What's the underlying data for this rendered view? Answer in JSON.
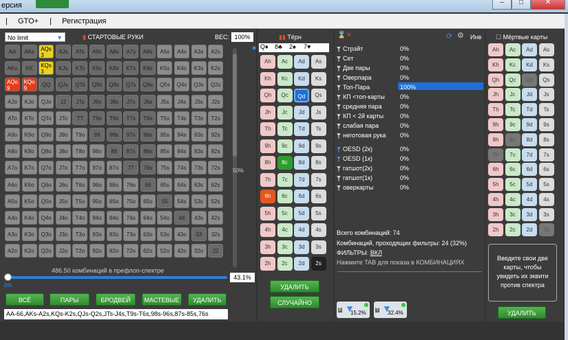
{
  "title": "ерсия",
  "menu": [
    "GTO+",
    "Регистрация"
  ],
  "left": {
    "limit_select": "No limit",
    "starting_hands_label": "СТАРТОВЫЕ РУКИ",
    "weight_label": "ВЕС:",
    "weight_value": "100%",
    "matrix": [
      [
        "AA",
        "AKs",
        "AQs",
        "AJs",
        "ATs",
        "A9s",
        "A8s",
        "A7s",
        "A6s",
        "A5s",
        "A4s",
        "A3s",
        "A2s"
      ],
      [
        "AKo",
        "KK",
        "KQs",
        "KJs",
        "KTs",
        "K9s",
        "K8s",
        "K7s",
        "K6s",
        "K5s",
        "K4s",
        "K3s",
        "K2s"
      ],
      [
        "AQo",
        "KQo",
        "QQ",
        "QJs",
        "QTs",
        "Q9s",
        "Q8s",
        "Q7s",
        "Q6s",
        "Q5s",
        "Q4s",
        "Q3s",
        "Q2s"
      ],
      [
        "AJo",
        "KJo",
        "QJo",
        "JJ",
        "JTs",
        "J9s",
        "J8s",
        "J7s",
        "J6s",
        "J5s",
        "J4s",
        "J3s",
        "J2s"
      ],
      [
        "ATo",
        "KTo",
        "QTo",
        "JTo",
        "TT",
        "T9s",
        "T8s",
        "T7s",
        "T6s",
        "T5s",
        "T4s",
        "T3s",
        "T2s"
      ],
      [
        "A9o",
        "K9o",
        "Q9o",
        "J9o",
        "T9o",
        "99",
        "98s",
        "97s",
        "96s",
        "95s",
        "94s",
        "93s",
        "92s"
      ],
      [
        "A8o",
        "K8o",
        "Q8o",
        "J8o",
        "T8o",
        "98o",
        "88",
        "87s",
        "86s",
        "85s",
        "84s",
        "83s",
        "82s"
      ],
      [
        "A7o",
        "K7o",
        "Q7o",
        "J7o",
        "T7o",
        "97o",
        "87o",
        "77",
        "76s",
        "75s",
        "74s",
        "73s",
        "72s"
      ],
      [
        "A6o",
        "K6o",
        "Q6o",
        "J6o",
        "T6o",
        "96o",
        "86o",
        "76o",
        "66",
        "65s",
        "64s",
        "63s",
        "62s"
      ],
      [
        "A5o",
        "K5o",
        "Q5o",
        "J5o",
        "T5o",
        "95o",
        "85o",
        "75o",
        "65o",
        "55",
        "54s",
        "53s",
        "52s"
      ],
      [
        "A4o",
        "K4o",
        "Q4o",
        "J4o",
        "T4o",
        "94o",
        "84o",
        "74o",
        "64o",
        "54o",
        "44",
        "43s",
        "42s"
      ],
      [
        "A3o",
        "K3o",
        "Q3o",
        "J3o",
        "T3o",
        "93o",
        "83o",
        "73o",
        "63o",
        "53o",
        "43o",
        "33",
        "32s"
      ],
      [
        "A2o",
        "K2o",
        "Q2o",
        "J2o",
        "T2o",
        "92o",
        "82o",
        "72o",
        "62o",
        "52o",
        "42o",
        "32o",
        "22"
      ]
    ],
    "selected_yellow": {
      "AQs": "3",
      "KQs": "3"
    },
    "selected_red": {
      "AQo": "9",
      "KQo": "9"
    },
    "combos_text": "486.50 комбинаций в префлоп-спектре",
    "slider_left": "0%",
    "slider_right": "43.1%",
    "slider_side": "50%",
    "buttons": [
      "ВСЁ",
      "ПАРЫ",
      "БРОДВЕЙ",
      "МАСТЕВЫЕ",
      "УДАЛИТЬ"
    ],
    "range_text": "AA-66,AKs-A2s,KQs-K2s,QJs-Q2s,JTs-J4s,T9s-T6s,98s-96s,87s-85s,76s"
  },
  "board": {
    "title": "Тёрн",
    "cards": [
      "Q♦",
      "8♣",
      "2♠",
      "7♥"
    ],
    "columns": [
      [
        "Ah",
        "Kh",
        "Qh",
        "Jh",
        "Th",
        "9h",
        "8h",
        "7h",
        "6h",
        "5h",
        "4h",
        "3h",
        "2h"
      ],
      [
        "Ac",
        "Kc",
        "Qc",
        "Jc",
        "Tc",
        "9c",
        "8c",
        "7c",
        "6c",
        "5c",
        "4c",
        "3c",
        "2c"
      ],
      [
        "Ad",
        "Kd",
        "Qd",
        "Jd",
        "Td",
        "9d",
        "8d",
        "7d",
        "6d",
        "5d",
        "4d",
        "3d",
        "2d"
      ],
      [
        "As",
        "Ks",
        "Qs",
        "Js",
        "Ts",
        "9s",
        "8s",
        "7s",
        "6s",
        "5s",
        "4s",
        "3s",
        "2s"
      ]
    ],
    "delete_button": "УДАЛИТЬ",
    "random_button": "СЛУЧАЙНО"
  },
  "stats": {
    "top_label": "Инв",
    "rows": [
      {
        "label": "Стрэйт",
        "value": "0%"
      },
      {
        "label": "Сет",
        "value": "0%"
      },
      {
        "label": "Две пары",
        "value": "0%"
      },
      {
        "label": "Оверпара",
        "value": "0%"
      },
      {
        "label": "Топ-Пара",
        "value": "100%"
      },
      {
        "label": "КП <топ-карты",
        "value": "0%"
      },
      {
        "label": "средняя пара",
        "value": "0%"
      },
      {
        "label": "КП < 2й карты",
        "value": "0%"
      },
      {
        "label": "слабая пара",
        "value": "0%"
      },
      {
        "label": "неготовая рука",
        "value": "0%"
      },
      {
        "label": "OESD (2к)",
        "value": "0%"
      },
      {
        "label": "OESD (1к)",
        "value": "0%"
      },
      {
        "label": "гатшот(2к)",
        "value": "0%"
      },
      {
        "label": "гатшот(1к)",
        "value": "0%"
      },
      {
        "label": "оверкарты",
        "value": "0%"
      }
    ],
    "total_combos": "Всего комбинаций: 74",
    "filtered_combos": "Комбинаций, проходящих фильтры: 24 (32%)",
    "filters_label": "ФИЛЬТРЫ:",
    "filters_value": "ВКЛ",
    "hint": "Нажмите TAB для показа в КОМБИНАЦИЯХ",
    "filter1": "15.2%",
    "filter2": "32.4%"
  },
  "dead": {
    "title": "Мёртвые карты",
    "info": "Введите свои две карты, чтобы увидеть их эквити против спектра",
    "delete_button": "УДАЛИТЬ"
  }
}
